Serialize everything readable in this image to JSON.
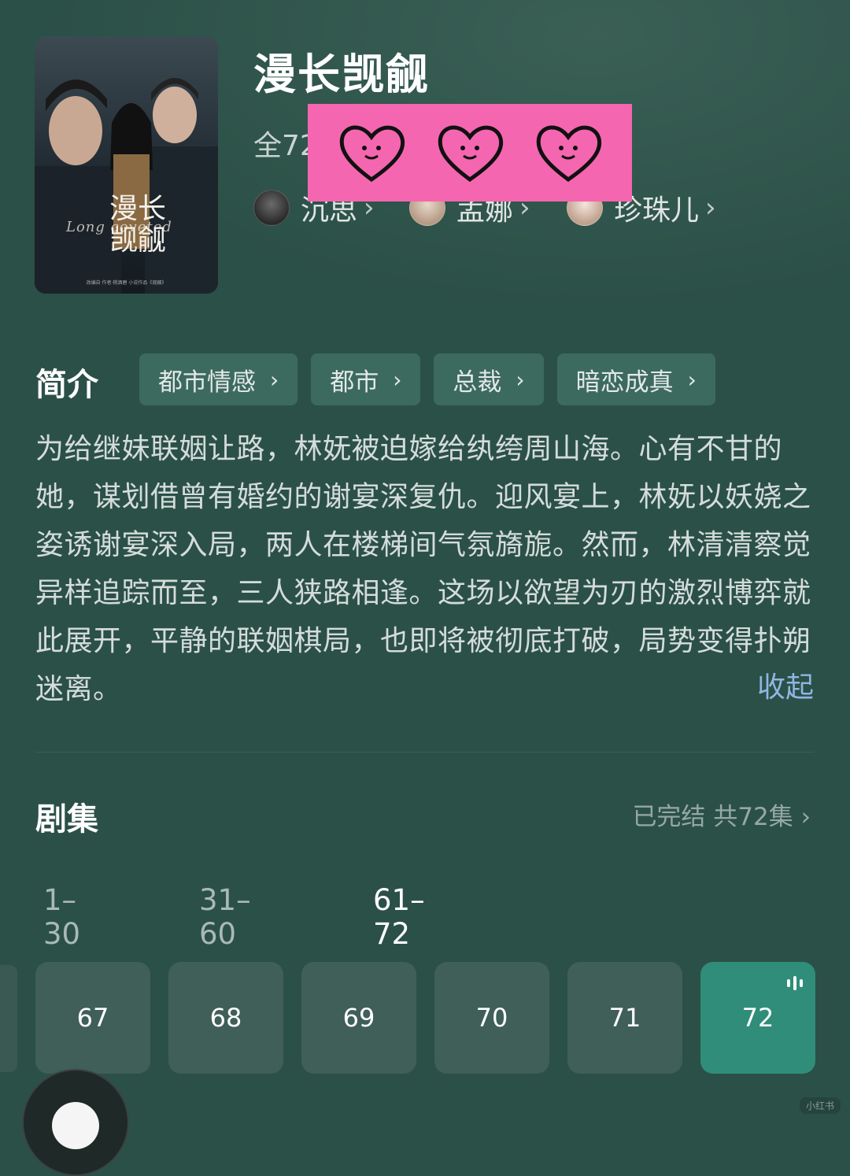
{
  "drama": {
    "title": "漫长觊觎",
    "poster": {
      "title": "漫长\n觊觎",
      "subtitle_en": "Long coveted",
      "credit": "改编自 作者·桃酒碧 小说作品《觊觎》"
    },
    "episodes_summary": "全72"
  },
  "cast": [
    {
      "name": "沉思",
      "avatar": "avatar-1"
    },
    {
      "name": "孟娜",
      "avatar": "avatar-2"
    },
    {
      "name": "珍珠儿",
      "avatar": "avatar-3"
    }
  ],
  "cast_chevron": "›",
  "sticker": {
    "color": "#f566b0",
    "icon": "heart-face-icon"
  },
  "intro": {
    "heading": "简介",
    "tags": [
      "都市情感",
      "都市",
      "总裁",
      "暗恋成真"
    ],
    "tag_chevron": "›",
    "synopsis": "为给继妹联姻让路，林妩被迫嫁给纨绔周山海。心有不甘的她，谋划借曾有婚约的谢宴深复仇。迎风宴上，林妩以妖娆之姿诱谢宴深入局，两人在楼梯间气氛旖旎。然而，林清清察觉异样追踪而至，三人狭路相逢。这场以欲望为刃的激烈博弈就此展开，平静的联姻棋局，也即将被彻底打破，局势变得扑朔迷离。",
    "collapse_label": "收起"
  },
  "episodes": {
    "heading": "剧集",
    "status": "已完结 共72集 ›",
    "ranges": [
      "1–30",
      "31–60",
      "61–72"
    ],
    "active_range": "61–72",
    "items": [
      "67",
      "68",
      "69",
      "70",
      "71",
      "72"
    ],
    "current": "72"
  },
  "watermark": "小红书",
  "colors": {
    "background": "#2b5047",
    "tag_bg": "#3d6a5f",
    "episode_bg": "#3f5f58",
    "episode_active": "#2f8d7a",
    "link": "#8fb6e3"
  }
}
